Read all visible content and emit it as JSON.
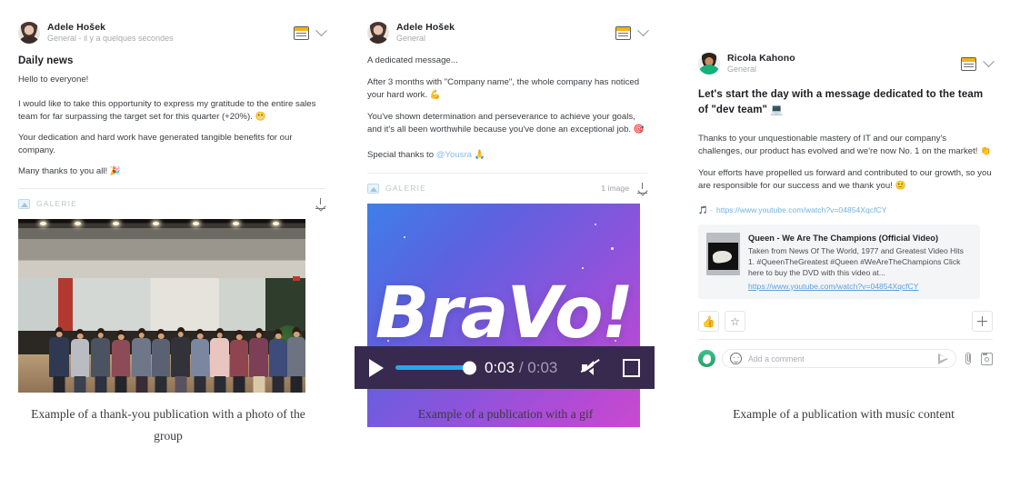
{
  "panels": [
    {
      "author": "Adele Hošek",
      "meta": "General - il y a quelques secondes",
      "title": "Daily news",
      "paragraphs": [
        "Hello to everyone!",
        "I would like to take this opportunity to express my gratitude to the entire sales team for far surpassing the target set for this quarter (+20%). 😬",
        "Your dedication and hard work have generated tangible benefits for our company.",
        "Many thanks to you all! 🎉"
      ],
      "gallery_label": "GALERIE",
      "gallery_count": "",
      "caption": "Example of a thank-you publication with a photo of the group"
    },
    {
      "author": "Adele Hošek",
      "meta": "General",
      "title": "",
      "paragraphs": [
        "A dedicated message...",
        "After 3 months with \"Company name\", the whole company has noticed your hard work. 💪",
        "You've shown determination and perseverance to achieve your goals, and it's all been worthwhile because you've done an exceptional job. 🎯",
        "Special thanks to "
      ],
      "mention": "@Yousra",
      "mention_suffix": " 🙏",
      "gallery_label": "GALERIE",
      "gallery_count": "1 image",
      "gif_text": "BraVo!",
      "video": {
        "current_time": "0:03",
        "separator": "/",
        "total_time": "0:03",
        "progress_percent": 100
      },
      "caption": "Example of a publication with a gif"
    },
    {
      "author": "Ricola Kahono",
      "meta": "General",
      "title": "Let's start the day with a message dedicated to the team of \"dev team\" 💻",
      "paragraphs": [
        "Thanks to your unquestionable mastery of IT and our company's challenges, our product has evolved and we're now No. 1 on the market! 👏",
        "Your efforts have propelled us forward and contributed to our growth, so you are responsible for our success and we thank you! 🙂"
      ],
      "link_prefix": "🎵 - ",
      "link_url": "https://www.youtube.com/watch?v=04854XqcfCY",
      "youtube_card": {
        "title": "Queen - We Are The Champions (Official Video)",
        "description": "Taken from News Of The World, 1977 and Greatest Video Hits 1. #QueenTheGreatest #Queen #WeAreTheChampions Click here to buy the DVD with this video at...",
        "url": "https://www.youtube.com/watch?v=04854XqcfCY"
      },
      "actions": {
        "like": "👍",
        "favorite": "☆",
        "add": "+"
      },
      "comment_placeholder": "Add a comment",
      "caption": "Example of a publication with music content"
    }
  ],
  "colors": {
    "accent_blue": "#2aa7e8",
    "news_icon_yellow": "#f2b318",
    "link_blue": "#5b9fe0",
    "video_bar": "#382a4e",
    "mention": "#8bb8e8"
  }
}
